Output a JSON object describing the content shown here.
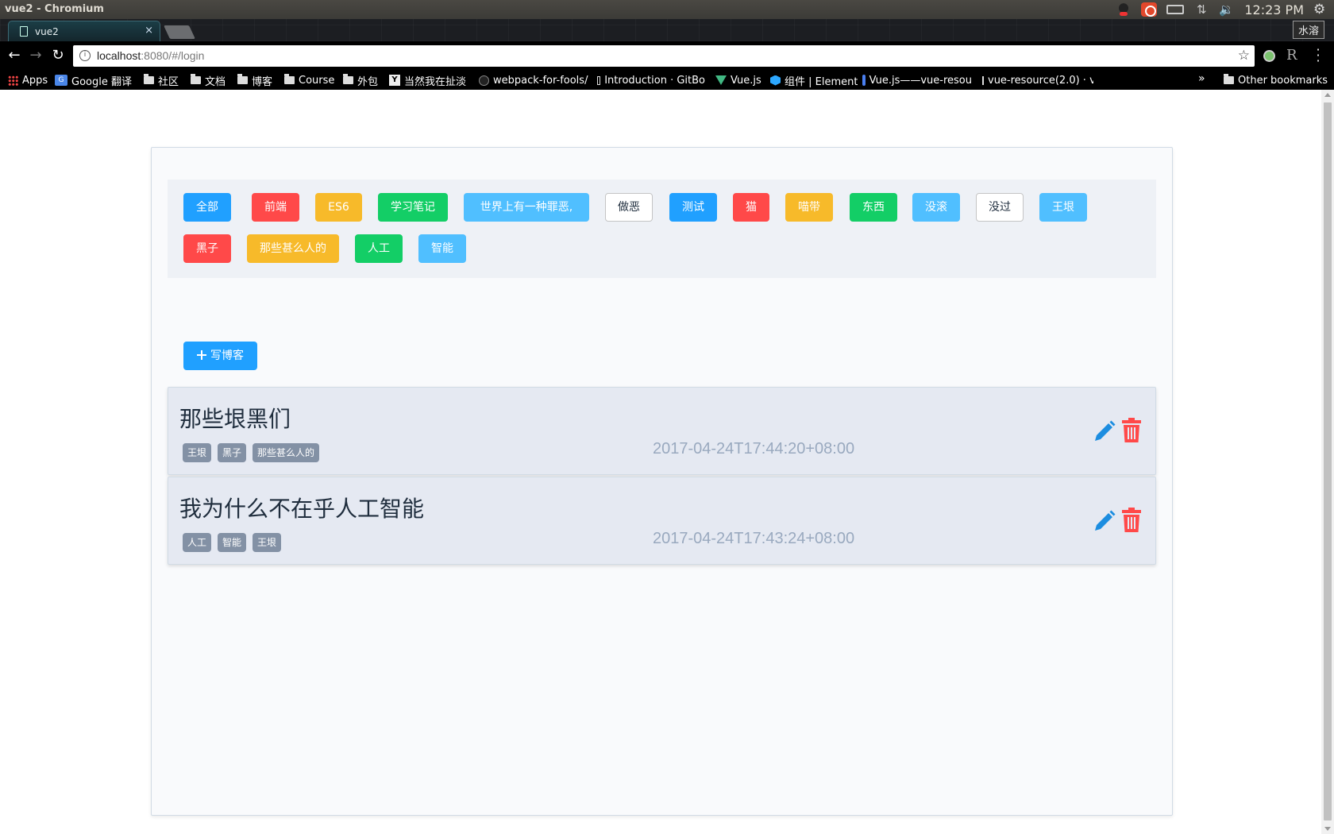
{
  "os": {
    "window_title": "vue2 - Chromium",
    "clock": "12:23 PM"
  },
  "browser": {
    "tab_title": "vue2",
    "tab_close": "×",
    "ime_label": "水溶",
    "url_host": "localhost",
    "url_rest": ":8080/#/login",
    "bookmarks": [
      {
        "label": "Apps",
        "icon": "apps-icon"
      },
      {
        "label": "Google 翻译",
        "icon": "google-translate-icon"
      },
      {
        "label": "社区",
        "icon": "folder-icon"
      },
      {
        "label": "文档",
        "icon": "folder-icon"
      },
      {
        "label": "博客",
        "icon": "folder-icon"
      },
      {
        "label": "Course",
        "icon": "folder-icon"
      },
      {
        "label": "外包",
        "icon": "folder-icon"
      },
      {
        "label": "当然我在扯淡",
        "icon": "y-icon"
      },
      {
        "label": "webpack-for-fools/",
        "icon": "github-icon"
      },
      {
        "label": "Introduction · GitBo",
        "icon": "gitbook-icon"
      },
      {
        "label": "Vue.js",
        "icon": "vue-icon"
      },
      {
        "label": "组件 | Element",
        "icon": "element-icon"
      },
      {
        "label": "Vue.js——vue-resou",
        "icon": "vue-resource-icon"
      },
      {
        "label": "vue-resource(2.0) · v",
        "icon": "gitbook-icon"
      }
    ],
    "more_bookmarks": "»",
    "other_bookmarks": "Other bookmarks"
  },
  "tags": [
    {
      "label": "全部",
      "color": "#20a0ff"
    },
    {
      "label": "前端",
      "color": "#ff4949"
    },
    {
      "label": "ES6",
      "color": "#f7ba2a"
    },
    {
      "label": "学习笔记",
      "color": "#13ce66"
    },
    {
      "label": "世界上有一种罪恶,",
      "color": "#50bfff"
    },
    {
      "label": "做恶",
      "color": "#ffffff"
    },
    {
      "label": "测试",
      "color": "#20a0ff"
    },
    {
      "label": "猫",
      "color": "#ff4949"
    },
    {
      "label": "喵带",
      "color": "#f7ba2a"
    },
    {
      "label": "东西",
      "color": "#13ce66"
    },
    {
      "label": "没滚",
      "color": "#50bfff"
    },
    {
      "label": "没过",
      "color": "#ffffff"
    },
    {
      "label": "王垠",
      "color": "#50bfff"
    },
    {
      "label": "黑子",
      "color": "#ff4949"
    },
    {
      "label": "那些甚么人的",
      "color": "#f7ba2a"
    },
    {
      "label": "人工",
      "color": "#13ce66"
    },
    {
      "label": "智能",
      "color": "#50bfff"
    }
  ],
  "write_button": "写博客",
  "posts": [
    {
      "title": "那些垠黑们",
      "tags": [
        "王垠",
        "黑子",
        "那些甚么人的"
      ],
      "date": "2017-04-24T17:44:20+08:00"
    },
    {
      "title": "我为什么不在乎人工智能",
      "tags": [
        "人工",
        "智能",
        "王垠"
      ],
      "date": "2017-04-24T17:43:24+08:00"
    }
  ],
  "colors": {
    "primary": "#20a0ff",
    "danger": "#ff4949",
    "edit_icon": "#1c8de0",
    "delete_icon": "#ff4949"
  }
}
